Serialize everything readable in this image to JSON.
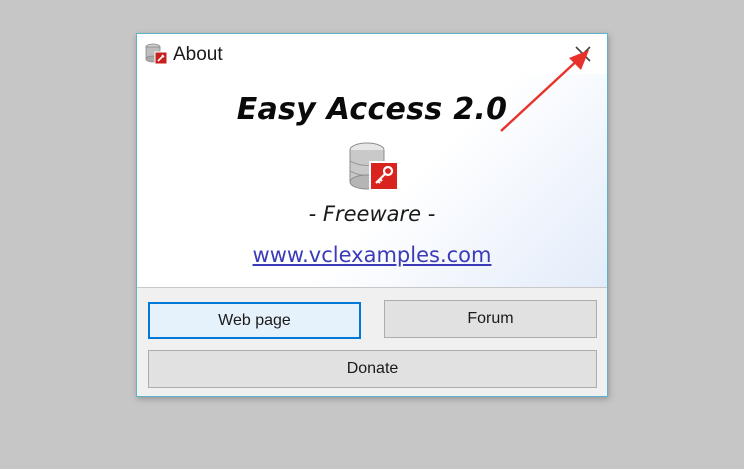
{
  "window": {
    "title": "About",
    "close_icon": "close-icon"
  },
  "about": {
    "app_name": "Easy Access 2.0",
    "license": "- Freeware -",
    "website": "www.vclexamples.com",
    "logo_icon": "database-key-icon"
  },
  "buttons": {
    "web_page": "Web page",
    "forum": "Forum",
    "donate": "Donate"
  },
  "annotation": {
    "arrow_color": "#e8312a",
    "points_to": "close-button"
  },
  "colors": {
    "desktop_background": "#c6c6c6",
    "window_border": "#5fb3c8",
    "link": "#3b3bb8",
    "focused_button_border": "#0078d7"
  }
}
